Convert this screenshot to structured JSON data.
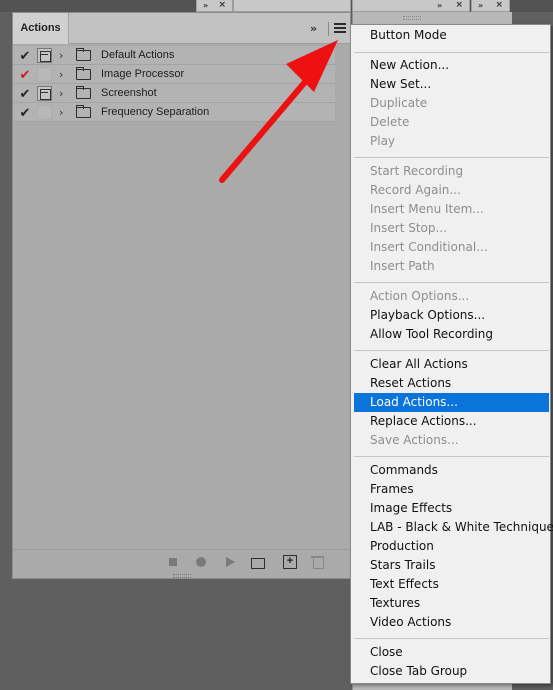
{
  "panel": {
    "tab_label": "Actions",
    "collapse_glyph": "»",
    "rows": [
      {
        "check": "✔",
        "check_color": "#222222",
        "dialog": "on",
        "expander": "›",
        "label": "Default Actions"
      },
      {
        "check": "✔",
        "check_color": "#d11a1a",
        "dialog": "off",
        "expander": "›",
        "label": "Image Processor"
      },
      {
        "check": "✔",
        "check_color": "#222222",
        "dialog": "on",
        "expander": "›",
        "label": "Screenshot"
      },
      {
        "check": "✔",
        "check_color": "#222222",
        "dialog": "off",
        "expander": "›",
        "label": "Frequency Separation"
      }
    ],
    "footer_icons": [
      "stop-icon",
      "record-icon",
      "play-icon",
      "folder-icon",
      "new-action-icon",
      "trash-icon"
    ]
  },
  "dock": {
    "tab_arrows": "»",
    "tab_close": "×"
  },
  "menu": {
    "items": [
      "Button Mode",
      "New Action...",
      "New Set...",
      "Duplicate",
      "Delete",
      "Play",
      "Start Recording",
      "Record Again...",
      "Insert Menu Item...",
      "Insert Stop...",
      "Insert Conditional...",
      "Insert Path",
      "Action Options...",
      "Playback Options...",
      "Allow Tool Recording",
      "Clear All Actions",
      "Reset Actions",
      "Load Actions...",
      "Replace Actions...",
      "Save Actions...",
      "Commands",
      "Frames",
      "Image Effects",
      "LAB - Black & White Technique",
      "Production",
      "Stars Trails",
      "Text Effects",
      "Textures",
      "Video Actions",
      "Close",
      "Close Tab Group"
    ],
    "disabled": [
      "Duplicate",
      "Delete",
      "Play",
      "Start Recording",
      "Record Again...",
      "Insert Menu Item...",
      "Insert Stop...",
      "Insert Conditional...",
      "Insert Path",
      "Action Options...",
      "Save Actions..."
    ],
    "highlighted": "Load Actions...",
    "highlight_color": "#0a74da"
  },
  "annotation": {
    "arrow_color": "#ee1111"
  }
}
